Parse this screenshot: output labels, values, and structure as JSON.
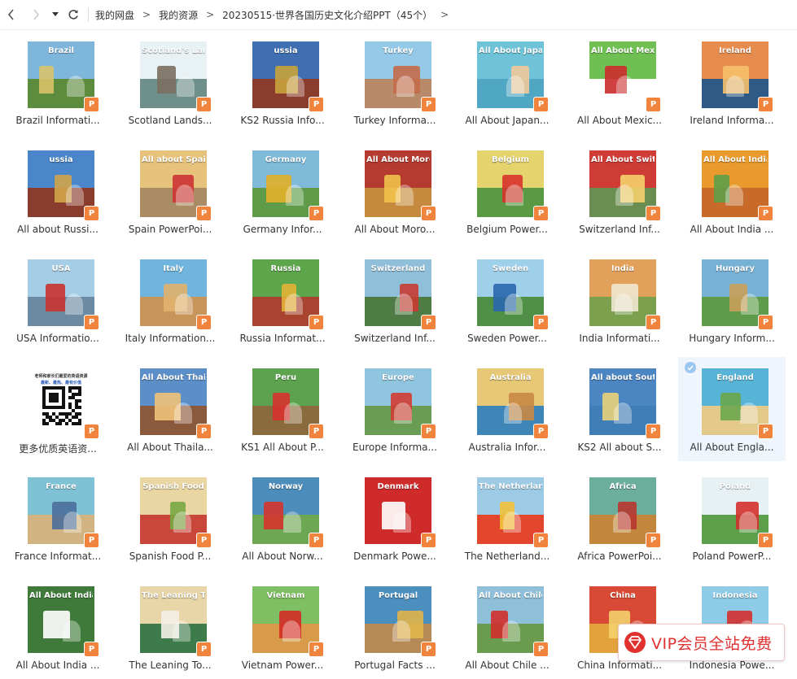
{
  "nav": {
    "back": "back-icon",
    "forward": "forward-icon",
    "history": "history-dropdown-icon",
    "refresh": "refresh-icon"
  },
  "breadcrumb": [
    "我的网盘",
    "我的资源",
    "20230515·世界各国历史文化介绍PPT（45个）"
  ],
  "breadcrumb_sep": ">",
  "badge_label": "P",
  "files": [
    {
      "name": "Brazil Informati...",
      "thumb_text": "Brazil",
      "sky": "#7fb7dc",
      "ground": "#5d8c3f",
      "accent": "#d9c36a"
    },
    {
      "name": "Scotland Lands...",
      "thumb_text": "Scotland's Landscape",
      "sky": "#e8f1f3",
      "ground": "#6f8f8a",
      "accent": "#7a6f60"
    },
    {
      "name": "KS2 Russia Info...",
      "thumb_text": "ussia",
      "sky": "#3f6fb0",
      "ground": "#8a3d2d",
      "accent": "#c8a23c"
    },
    {
      "name": "Turkey Informa...",
      "thumb_text": "Turkey",
      "sky": "#94c9e8",
      "ground": "#b98a6a",
      "accent": "#c46b4a"
    },
    {
      "name": "All About Japan...",
      "thumb_text": "All About Japan",
      "sky": "#6ec3d8",
      "ground": "#4fa7c3",
      "accent": "#f1c99a"
    },
    {
      "name": "All About Mexic...",
      "thumb_text": "All About Mexico",
      "sky": "#6fbf53",
      "ground": "#ffffff",
      "accent": "#cc2b2b"
    },
    {
      "name": "Ireland Informa...",
      "thumb_text": "Ireland",
      "sky": "#e58c4e",
      "ground": "#2f5a85",
      "accent": "#f6c06a"
    },
    {
      "name": "All about Russi...",
      "thumb_text": "ussia",
      "sky": "#4a86c9",
      "ground": "#8a3d2d",
      "accent": "#d0a44a"
    },
    {
      "name": "Spain PowerPoi...",
      "thumb_text": "All about Spain",
      "sky": "#e6c27a",
      "ground": "#a98c63",
      "accent": "#c33"
    },
    {
      "name": "Germany Infor...",
      "thumb_text": "Germany",
      "sky": "#7fbad9",
      "ground": "#5f9b49",
      "accent": "#e2b028"
    },
    {
      "name": "All About Moro...",
      "thumb_text": "All About Morocco",
      "sky": "#b53a2f",
      "ground": "#c58a3d",
      "accent": "#f1c24d"
    },
    {
      "name": "Belgium Power...",
      "thumb_text": "Belgium",
      "sky": "#e5d36e",
      "ground": "#5b9a45",
      "accent": "#d7342b"
    },
    {
      "name": "Switzerland Inf...",
      "thumb_text": "All About Switzerland",
      "sky": "#cf3b35",
      "ground": "#6a8e52",
      "accent": "#f4d06b"
    },
    {
      "name": "All About India ...",
      "thumb_text": "All About India",
      "sky": "#e89a2c",
      "ground": "#c76a2a",
      "accent": "#5e9f4a"
    },
    {
      "name": "USA Informatio...",
      "thumb_text": "USA",
      "sky": "#a5cde6",
      "ground": "#6d8aa3",
      "accent": "#c8342f"
    },
    {
      "name": "Italy Information...",
      "thumb_text": "Italy",
      "sky": "#6fb5dd",
      "ground": "#c7945a",
      "accent": "#e0b26d"
    },
    {
      "name": "Russia Informat...",
      "thumb_text": "Russia",
      "sky": "#5ea64c",
      "ground": "#a8442f",
      "accent": "#e3b437"
    },
    {
      "name": "Switzerland Inf...",
      "thumb_text": "Switzerland",
      "sky": "#8fbfd9",
      "ground": "#4f7b44",
      "accent": "#c83b33"
    },
    {
      "name": "Sweden Power...",
      "thumb_text": "Sweden",
      "sky": "#9fd0ea",
      "ground": "#4f8f46",
      "accent": "#2a66ad"
    },
    {
      "name": "India Informati...",
      "thumb_text": "India",
      "sky": "#e2a15a",
      "ground": "#7ba14f",
      "accent": "#f1e6d0"
    },
    {
      "name": "Hungary Inform...",
      "thumb_text": "Hungary",
      "sky": "#77b2d6",
      "ground": "#5e9b4b",
      "accent": "#c9a05a"
    },
    {
      "name": "更多优质英语资...",
      "thumb_text": "",
      "qr": true,
      "qr_line1": "老师和家长们最爱的英语资源",
      "qr_line2": "最新、最热、最有价值",
      "sky": "#ffffff",
      "ground": "#ffffff",
      "accent": "#111111"
    },
    {
      "name": "All About Thaila...",
      "thumb_text": "All About Thailand",
      "sky": "#5c8fc8",
      "ground": "#8b5a3c",
      "accent": "#f0c27a"
    },
    {
      "name": "KS1 All About P...",
      "thumb_text": "Peru",
      "sky": "#5da24e",
      "ground": "#8a6b3d",
      "accent": "#d7322d"
    },
    {
      "name": "Europe Informa...",
      "thumb_text": "Europe",
      "sky": "#8fc5de",
      "ground": "#6b9c54",
      "accent": "#d13c33"
    },
    {
      "name": "Australia Infor...",
      "thumb_text": "Australia",
      "sky": "#e7c877",
      "ground": "#3f86b8",
      "accent": "#c98845"
    },
    {
      "name": "KS2 All about S...",
      "thumb_text": "All about South Korea",
      "sky": "#4b86c3",
      "ground": "#3f7eb6",
      "accent": "#e8d27a"
    },
    {
      "name": "All About Engla...",
      "thumb_text": "England",
      "sky": "#58b4d6",
      "ground": "#e3c98a",
      "accent": "#6aa64d",
      "selected": true
    },
    {
      "name": "France Informat...",
      "thumb_text": "France",
      "sky": "#7fc2d6",
      "ground": "#d1b482",
      "accent": "#4b6f9b"
    },
    {
      "name": "Spanish Food P...",
      "thumb_text": "Spanish Food",
      "sky": "#e9d6a2",
      "ground": "#c8463a",
      "accent": "#78a844"
    },
    {
      "name": "All About Norw...",
      "thumb_text": "Norway",
      "sky": "#4c8dbb",
      "ground": "#6ea753",
      "accent": "#d5342d"
    },
    {
      "name": "Denmark Powe...",
      "thumb_text": "Denmark",
      "sky": "#d02b2b",
      "ground": "#d02b2b",
      "accent": "#ffffff"
    },
    {
      "name": "The Netherland...",
      "thumb_text": "The Netherlands",
      "sky": "#9dcbe6",
      "ground": "#e2472e",
      "accent": "#f2c23a"
    },
    {
      "name": "Africa PowerPoi...",
      "thumb_text": "Africa",
      "sky": "#6cae9c",
      "ground": "#c2873d",
      "accent": "#b8362f"
    },
    {
      "name": "Poland PowerP...",
      "thumb_text": "Poland",
      "sky": "#e7f1f4",
      "ground": "#5da04b",
      "accent": "#d4302e"
    },
    {
      "name": "All About India ...",
      "thumb_text": "All About India",
      "sky": "#3f7a3a",
      "ground": "#3f7a3a",
      "accent": "#ffffff"
    },
    {
      "name": "The Leaning To...",
      "thumb_text": "The Leaning Tower of Pisa",
      "sky": "#e8d6a8",
      "ground": "#3e7b4a",
      "accent": "#f3efe5"
    },
    {
      "name": "Vietnam Power...",
      "thumb_text": "Vietnam",
      "sky": "#7fbf63",
      "ground": "#d89b4b",
      "accent": "#d52b27"
    },
    {
      "name": "Portugal Facts ...",
      "thumb_text": "Portugal",
      "sky": "#4b8fbf",
      "ground": "#b58a57",
      "accent": "#e0b44a"
    },
    {
      "name": "All About Chile ...",
      "thumb_text": "All About Chile",
      "sky": "#8fc0d9",
      "ground": "#6a9b4f",
      "accent": "#d12e2b"
    },
    {
      "name": "China Informati...",
      "thumb_text": "China",
      "sky": "#d84a35",
      "ground": "#e3a23c",
      "accent": "#f3d16b"
    },
    {
      "name": "Indonesia Powe...",
      "thumb_text": "Indonesia",
      "sky": "#8ecbe6",
      "ground": "#5fa7d0",
      "accent": "#d4302e"
    }
  ],
  "vip_banner": {
    "text": "VIP会员全站免费",
    "icon": "diamond-icon",
    "color": "#e0312f"
  }
}
